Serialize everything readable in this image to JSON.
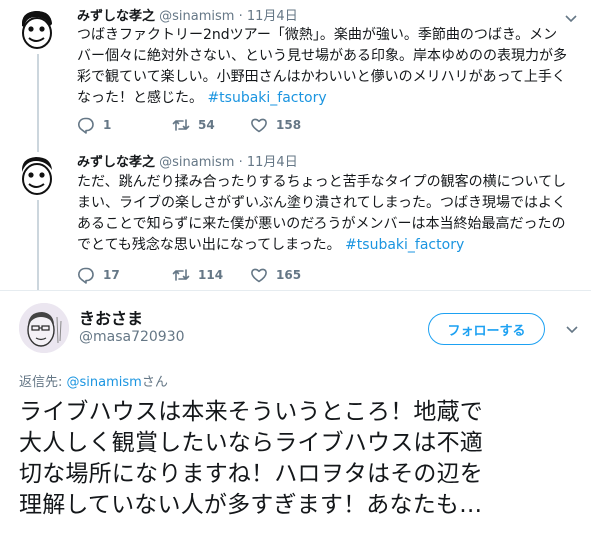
{
  "tweet1": {
    "name": "みずしな孝之",
    "handle": "@sinamism",
    "dot": "·",
    "date": "11月4日",
    "text_lines": [
      "つばきファクトリー2ndツアー「微熱」。楽曲が強い。季節曲のつばき。メン",
      "バー個々に絶対外さない、という見せ場がある印象。岸本ゆめのの表現力が多",
      "彩で観ていて楽しい。小野田さんはかわいいと儚いのメリハリがあって上手く",
      "なった！と感じた。"
    ],
    "hashtag": "#tsubaki_factory",
    "replies": "1",
    "retweets": "54",
    "likes": "158"
  },
  "tweet2": {
    "name": "みずしな孝之",
    "handle": "@sinamism",
    "dot": "·",
    "date": "11月4日",
    "text_lines": [
      "ただ、跳んだり揉み合ったりするちょっと苦手なタイプの観客の横についてし",
      "まい、ライブの楽しさがずいぶん塗り潰されてしまった。つばき現場ではよく",
      "あることで知らずに来た僕が悪いのだろうがメンバーは本当終始最高だったの",
      "でとても残念な思い出になってしまった。"
    ],
    "hashtag": "#tsubaki_factory",
    "replies": "17",
    "retweets": "114",
    "likes": "165"
  },
  "main": {
    "name": "きおさま",
    "handle": "@masa720930",
    "follow_label": "フォローする",
    "reply_prefix": "返信先: ",
    "reply_mention": "@sinamism",
    "reply_suffix": "さん",
    "text_lines": [
      "ライブハウスは本来そういうところ！地蔵で",
      "大人しく観賞したいならライブハウスは不適",
      "切な場所になりますね！ハロヲタはその辺を",
      "理解していない人が多すぎます！あなたも…"
    ]
  },
  "colors": {
    "link": "#1b95e0",
    "accent": "#1da1f2",
    "muted": "#657786",
    "text": "#14171a"
  },
  "icons": [
    "reply-icon",
    "retweet-icon",
    "like-icon",
    "caret-down-icon",
    "avatar-cartoon",
    "avatar-photo"
  ]
}
